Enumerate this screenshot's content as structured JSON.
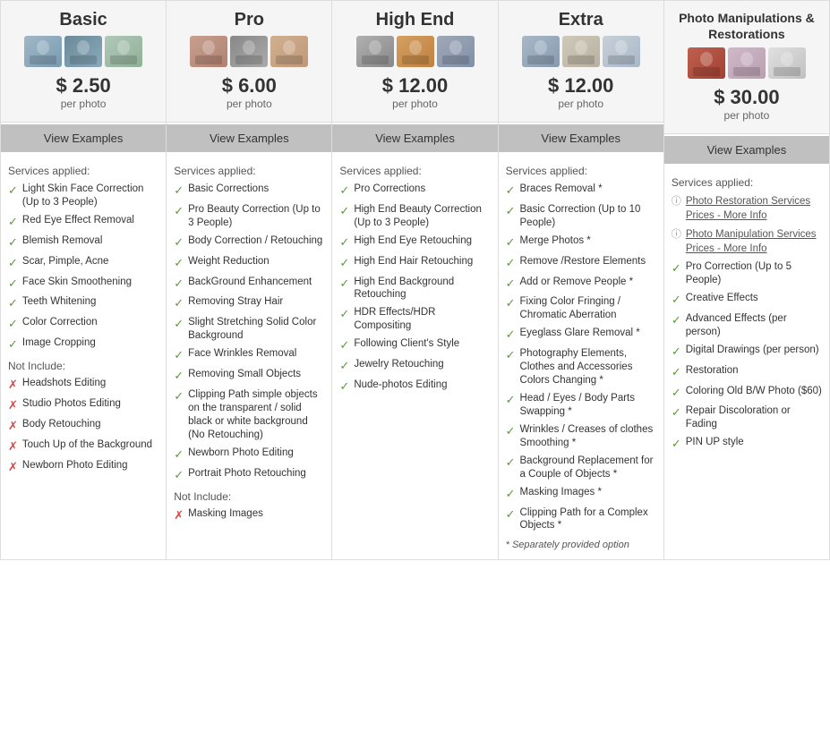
{
  "columns": [
    {
      "id": "basic",
      "title": "Basic",
      "title_small": false,
      "price": "$ 2.50",
      "price_sub": "per photo",
      "view_examples": "View Examples",
      "photos": [
        {
          "color": "#a0b8c8",
          "color2": "#7a9ab0"
        },
        {
          "color": "#6a8a9a",
          "color2": "#8aaabb"
        },
        {
          "color": "#b0c8b8",
          "color2": "#90b098"
        }
      ],
      "services_label": "Services applied:",
      "included": [
        "Light Skin Face Correction (Up to 3 People)",
        "Red Eye Effect Removal",
        "Blemish Removal",
        "Scar, Pimple, Acne",
        "Face Skin Smoothening",
        "Teeth Whitening",
        "Color Correction",
        "Image Cropping"
      ],
      "not_include_label": "Not Include:",
      "excluded": [
        "Headshots Editing",
        "Studio Photos Editing",
        "Body Retouching",
        "Touch Up of the Background",
        "Newborn Photo Editing"
      ]
    },
    {
      "id": "pro",
      "title": "Pro",
      "title_small": false,
      "price": "$ 6.00",
      "price_sub": "per photo",
      "view_examples": "View Examples",
      "photos": [
        {
          "color": "#c8a090",
          "color2": "#b08070"
        },
        {
          "color": "#888888",
          "color2": "#aaaaaa"
        },
        {
          "color": "#d0b090",
          "color2": "#c09878"
        }
      ],
      "services_label": "Services applied:",
      "included": [
        "Basic Corrections",
        "Pro Beauty Correction (Up to 3 People)",
        "Body Correction / Retouching",
        "Weight Reduction",
        "BackGround Enhancement",
        "Removing Stray Hair",
        "Slight Stretching Solid Color Background",
        "Face Wrinkles Removal",
        "Removing Small Objects",
        "Clipping Path simple objects on the transparent / solid black or white background (No Retouching)",
        "Newborn Photo Editing",
        "Portrait Photo Retouching"
      ],
      "not_include_label": "Not Include:",
      "excluded": [
        "Masking Images"
      ]
    },
    {
      "id": "high-end",
      "title": "High End",
      "title_small": false,
      "price": "$ 12.00",
      "price_sub": "per photo",
      "view_examples": "View Examples",
      "photos": [
        {
          "color": "#b0b0b0",
          "color2": "#888888"
        },
        {
          "color": "#d4a060",
          "color2": "#c08040"
        },
        {
          "color": "#a0a8b8",
          "color2": "#8090a8"
        }
      ],
      "services_label": "Services applied:",
      "included": [
        "Pro Corrections",
        "High End Beauty Correction (Up to 3 People)",
        "High End Eye Retouching",
        "High End Hair Retouching",
        "High End Background Retouching",
        "HDR Effects/HDR Compositing",
        "Following Client's Style",
        "Jewelry Retouching",
        "Nude-photos Editing"
      ],
      "not_include_label": null,
      "excluded": []
    },
    {
      "id": "extra",
      "title": "Extra",
      "title_small": false,
      "price": "$ 12.00",
      "price_sub": "per photo",
      "view_examples": "View Examples",
      "photos": [
        {
          "color": "#a8b8c8",
          "color2": "#889ab0"
        },
        {
          "color": "#d0c8b8",
          "color2": "#b8b0a0"
        },
        {
          "color": "#c8d0d8",
          "color2": "#a8b8c8"
        }
      ],
      "services_label": "Services applied:",
      "included": [
        "Braces Removal *",
        "Basic Correction (Up to 10 People)",
        "Merge Photos *",
        "Remove /Restore Elements",
        "Add or Remove People *",
        "Fixing Color Fringing / Chromatic Aberration",
        "Eyeglass Glare Removal *",
        "Photography Elements, Clothes and Accessories Colors Changing *",
        "Head / Eyes / Body Parts Swapping *",
        "Wrinkles / Creases of clothes Smoothing *",
        "Background Replacement for a Couple of Objects *",
        "Masking Images *",
        "Clipping Path for a Complex Objects *"
      ],
      "not_include_label": null,
      "excluded": [],
      "footnote": "* Separately provided option"
    },
    {
      "id": "photo-manipulations",
      "title": "Photo Manipulations &\nRestorations",
      "title_small": true,
      "price": "$ 30.00",
      "price_sub": "per photo",
      "view_examples": "View Examples",
      "photos": [
        {
          "color": "#c06050",
          "color2": "#a04030"
        },
        {
          "color": "#d0b8c8",
          "color2": "#b8a0b0"
        },
        {
          "color": "#e0e0e0",
          "color2": "#c0c0c0"
        }
      ],
      "services_label": "Services applied:",
      "info_items": [
        {
          "label": "Photo Restoration Services",
          "sub": "Prices - More Info"
        },
        {
          "label": "Photo Manipulation Services",
          "sub": "Prices - More Info"
        }
      ],
      "included": [
        "Pro Correction (Up to 5 People)",
        "Creative Effects",
        "Advanced Effects (per person)",
        "Digital Drawings (per person)",
        "Restoration",
        "Coloring Old B/W Photo ($60)",
        "Repair Discoloration or Fading",
        "PIN UP style"
      ],
      "not_include_label": null,
      "excluded": []
    }
  ]
}
